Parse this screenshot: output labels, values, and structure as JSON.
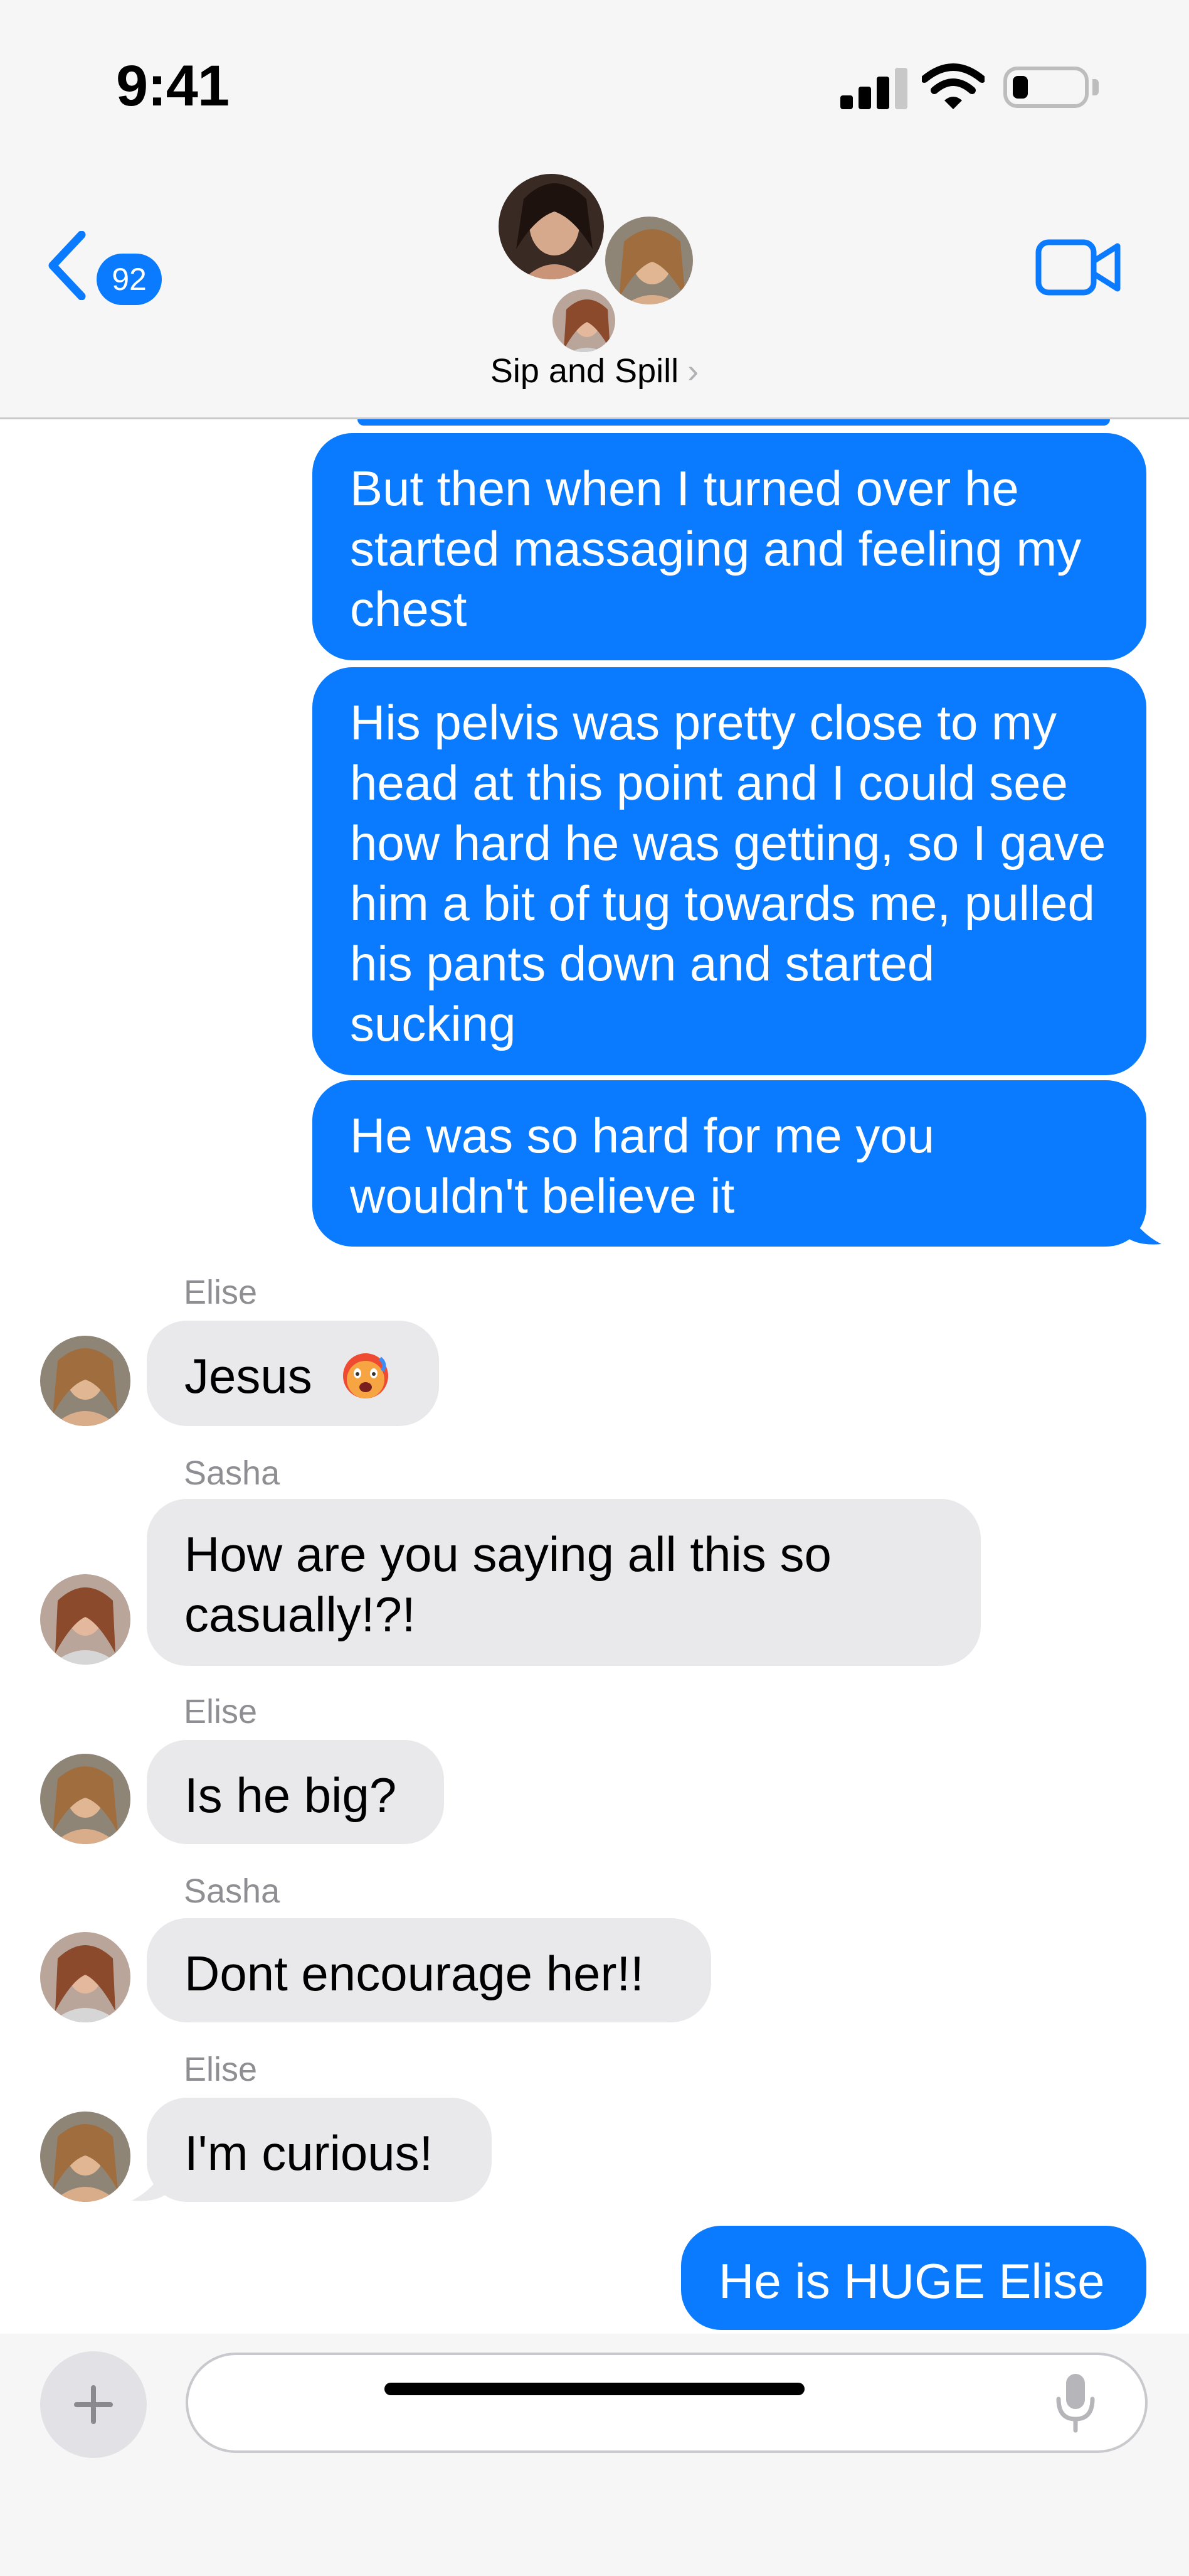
{
  "status_bar": {
    "time": "9:41"
  },
  "header": {
    "back_badge": "92",
    "group_name": "Sip and Spill",
    "name_chevron": "›"
  },
  "messages": [
    {
      "direction": "out",
      "text": "But then when I turned over he started massaging and feeling my chest"
    },
    {
      "direction": "out",
      "text": "His pelvis was pretty close to my head at this point and I could see how hard he was getting, so I gave him a bit of tug towards me, pulled his pants down and started sucking"
    },
    {
      "direction": "out",
      "text": "He was so hard for me you wouldn't believe it"
    },
    {
      "direction": "in",
      "sender": "Elise",
      "text": "Jesus",
      "emoji": "hot-face-icon"
    },
    {
      "direction": "in",
      "sender": "Sasha",
      "text": "How are you saying all this so casually!?!"
    },
    {
      "direction": "in",
      "sender": "Elise",
      "text": "Is he big?"
    },
    {
      "direction": "in",
      "sender": "Sasha",
      "text": "Dont encourage her!!"
    },
    {
      "direction": "in",
      "sender": "Elise",
      "text": "I'm curious!"
    },
    {
      "direction": "out",
      "text": "He is HUGE Elise"
    }
  ],
  "compose": {
    "placeholder": ""
  },
  "colors": {
    "outgoing_bubble": "#0a7bff",
    "incoming_bubble": "#e9e9eb",
    "accent": "#0a7bff",
    "header_bg": "#f6f6f6"
  },
  "icons": [
    "back-chevron-icon",
    "video-camera-icon",
    "plus-icon",
    "microphone-icon",
    "signal-icon",
    "wifi-icon",
    "battery-icon"
  ]
}
